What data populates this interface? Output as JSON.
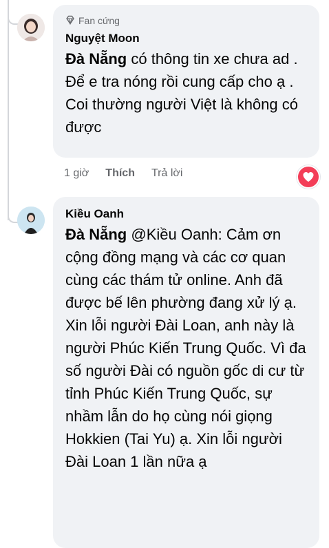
{
  "comments": [
    {
      "badge": "Fan cứng",
      "author": "Nguyệt Moon",
      "mention": "Đà Nẵng",
      "text": " có thông tin xe chưa ad . Để e tra nóng rồi cung cấp cho ạ . Coi thường người Việt là không có được",
      "time": "1 giờ",
      "like_label": "Thích",
      "reply_label": "Trả lời",
      "reaction_icon": "heart-icon"
    },
    {
      "author": "Kiều Oanh",
      "mention": "Đà Nẵng",
      "text": " @Kiều Oanh: Cảm ơn cộng đồng mạng và các cơ quan cùng các thám tử online. Anh đã được bế lên phường đang xử lý ạ. Xin lỗi người Đài Loan, anh này là người Phúc Kiến Trung Quốc. Vì đa số người Đài có nguồn gốc di cư từ tỉnh Phúc Kiến Trung Quốc, sự nhầm lẫn do họ cùng nói giọng Hokkien (Tai Yu) ạ. Xin lỗi người Đài Loan 1 lần nữa ạ"
    }
  ],
  "colors": {
    "bubble": "#f0f2f5",
    "reaction": "#f33e58",
    "meta_text": "#65676b"
  }
}
